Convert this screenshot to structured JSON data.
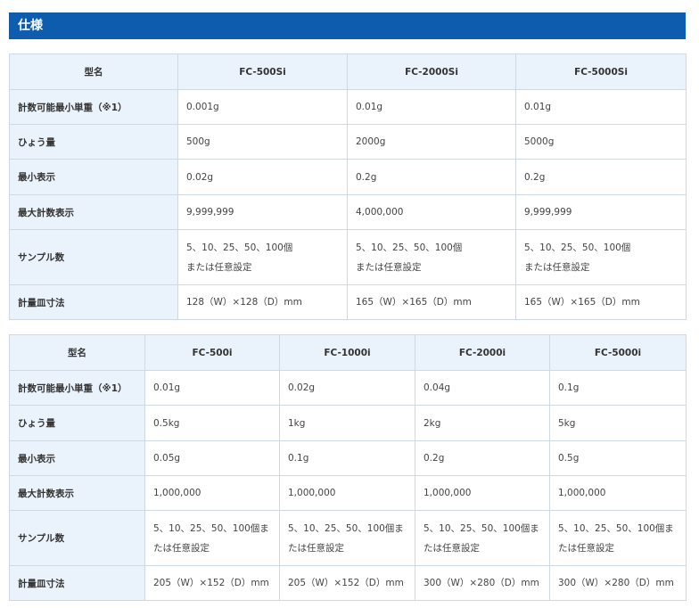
{
  "section_title": "仕様",
  "table1": {
    "header": [
      "型名",
      "FC-500Si",
      "FC-2000Si",
      "FC-5000Si"
    ],
    "rows": [
      {
        "label": "計数可能最小単重（※1）",
        "cells": [
          "0.001g",
          "0.01g",
          "0.01g"
        ]
      },
      {
        "label": "ひょう量",
        "cells": [
          "500g",
          "2000g",
          "5000g"
        ]
      },
      {
        "label": "最小表示",
        "cells": [
          "0.02g",
          "0.2g",
          "0.2g"
        ]
      },
      {
        "label": "最大計数表示",
        "cells": [
          "9,999,999",
          "4,000,000",
          "9,999,999"
        ]
      },
      {
        "label": "サンプル数",
        "cells": [
          "5、10、25、50、100個\nまたは任意設定",
          "5、10、25、50、100個\nまたは任意設定",
          "5、10、25、50、100個\nまたは任意設定"
        ]
      },
      {
        "label": "計量皿寸法",
        "cells": [
          "128（W）×128（D）mm",
          "165（W）×165（D）mm",
          "165（W）×165（D）mm"
        ]
      }
    ]
  },
  "table2": {
    "header": [
      "型名",
      "FC-500i",
      "FC-1000i",
      "FC-2000i",
      "FC-5000i"
    ],
    "rows": [
      {
        "label": "計数可能最小単重（※1）",
        "cells": [
          "0.01g",
          "0.02g",
          "0.04g",
          "0.1g"
        ]
      },
      {
        "label": "ひょう量",
        "cells": [
          "0.5kg",
          "1kg",
          "2kg",
          "5kg"
        ]
      },
      {
        "label": "最小表示",
        "cells": [
          "0.05g",
          "0.1g",
          "0.2g",
          "0.5g"
        ]
      },
      {
        "label": "最大計数表示",
        "cells": [
          "1,000,000",
          "1,000,000",
          "1,000,000",
          "1,000,000"
        ]
      },
      {
        "label": "サンプル数",
        "cells": [
          "5、10、25、50、100個ま\nたは任意設定",
          "5、10、25、50、100個ま\nたは任意設定",
          "5、10、25、50、100個ま\nたは任意設定",
          "5、10、25、50、100個ま\nたは任意設定"
        ]
      },
      {
        "label": "計量皿寸法",
        "cells": [
          "205（W）×152（D）mm",
          "205（W）×152（D）mm",
          "300（W）×280（D）mm",
          "300（W）×280（D）mm"
        ]
      }
    ]
  }
}
